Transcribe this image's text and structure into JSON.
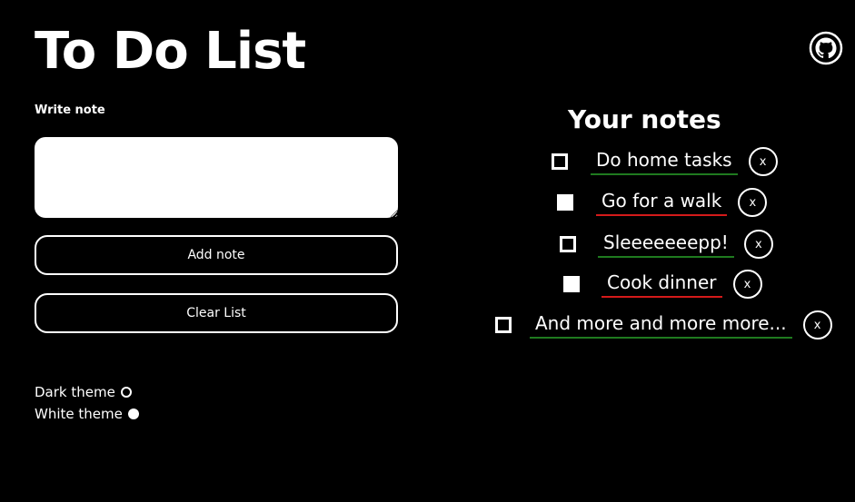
{
  "app": {
    "title": "To Do List",
    "github_icon": "github-icon"
  },
  "editor": {
    "label": "Write note",
    "input_value": "",
    "add_label": "Add note",
    "clear_label": "Clear List"
  },
  "themes": [
    {
      "label": "Dark theme",
      "selected": false
    },
    {
      "label": "White theme",
      "selected": true
    }
  ],
  "notes": {
    "title": "Your notes",
    "delete_label": "x",
    "items": [
      {
        "text": "Do home tasks",
        "checked": false,
        "underline": "#1f7a1f"
      },
      {
        "text": "Go for a walk",
        "checked": true,
        "underline": "#d41a1a"
      },
      {
        "text": "Sleeeeeeepp!",
        "checked": false,
        "underline": "#1f7a1f"
      },
      {
        "text": "Cook dinner",
        "checked": true,
        "underline": "#d41a1a"
      },
      {
        "text": "And more and more more...",
        "checked": false,
        "underline": "#1f7a1f"
      }
    ]
  },
  "colors": {
    "background": "#000000",
    "foreground": "#ffffff",
    "underline_done": "#d41a1a",
    "underline_pending": "#1f7a1f"
  }
}
